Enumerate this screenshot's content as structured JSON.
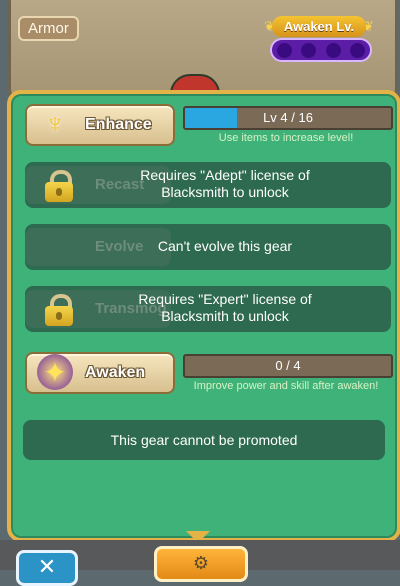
{
  "header": {
    "category": "Armor",
    "awaken_badge": {
      "title": "Awaken Lv.",
      "level_slots": 4
    }
  },
  "enhance": {
    "label": "Enhance",
    "icon": "trident-icon",
    "progress_text": "Lv 4 / 16",
    "progress_value": 0.25,
    "hint": "Use items to increase level!"
  },
  "recast": {
    "ghost_label": "Recast",
    "message": "Requires \"Adept\" license of Blacksmith to unlock"
  },
  "evolve": {
    "ghost_label": "Evolve",
    "message": "Can't evolve this gear"
  },
  "transmog": {
    "ghost_label": "Transmog",
    "message": "Requires \"Expert\" license of Blacksmith to unlock"
  },
  "awaken": {
    "label": "Awaken",
    "icon": "awaken-star-icon",
    "progress_text": "0 / 4",
    "progress_value": 0,
    "hint": "Improve power and skill after awaken!"
  },
  "promote": {
    "message": "This gear cannot be promoted"
  },
  "footer": {
    "close_icon": "close-icon",
    "center_icon": "gear-item-icon"
  },
  "colors": {
    "panel_green": "#3fb27a",
    "panel_border": "#e3b347",
    "progress_fill": "#2aa7e0"
  }
}
